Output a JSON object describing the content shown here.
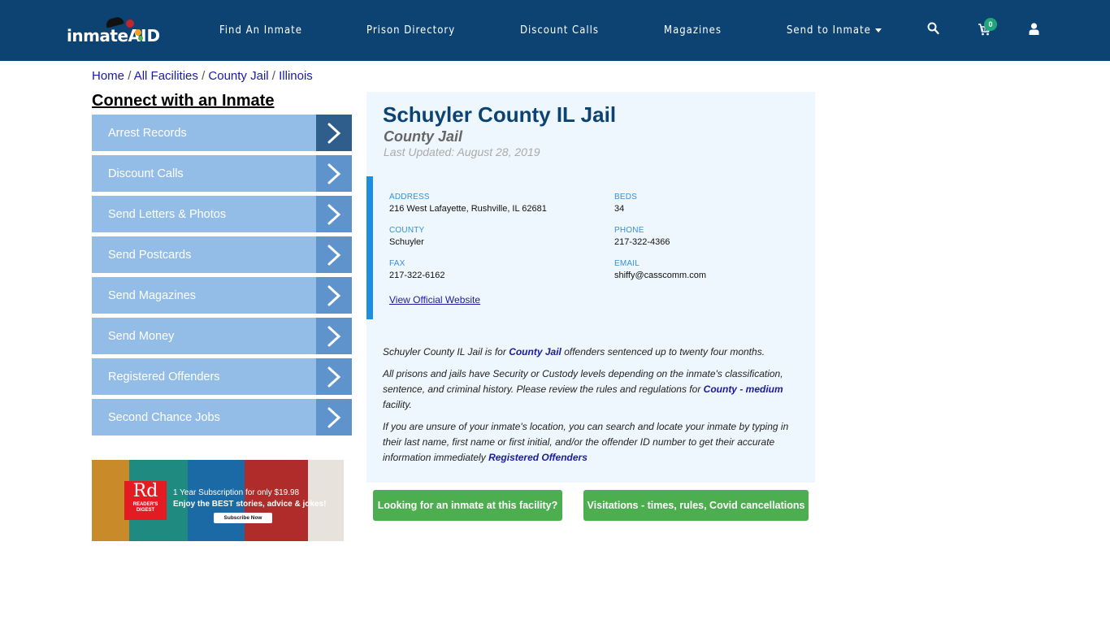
{
  "nav": {
    "logo_text": "inmate",
    "logo_aid": "AID",
    "links": [
      "Find An Inmate",
      "Prison Directory",
      "Discount Calls",
      "Magazines",
      "Send to Inmate"
    ],
    "cart_count": "0"
  },
  "breadcrumb": {
    "items": [
      "Home",
      "All Facilities",
      "County Jail",
      "Illinois"
    ],
    "separator": "/"
  },
  "sidebar": {
    "title": "Connect with an Inmate",
    "items": [
      "Arrest Records",
      "Discount Calls",
      "Send Letters & Photos",
      "Send Postcards",
      "Send Magazines",
      "Send Money",
      "Registered Offenders",
      "Second Chance Jobs"
    ]
  },
  "ad": {
    "logo": "Rd",
    "brand": "READER'S DIGEST",
    "line1": "1 Year Subscription for only $19.98",
    "line2": "Enjoy the BEST stories, advice & jokes!",
    "button": "Subscribe Now",
    "cover_colors": [
      "#c98a2a",
      "#1f8a80",
      "#1b6aa5",
      "#b02c2a",
      "#e8e2dc"
    ]
  },
  "facility": {
    "title": "Schuyler County IL Jail",
    "type": "County Jail",
    "last_updated": "Last Updated: August 28, 2019",
    "fields": {
      "address_label": "ADDRESS",
      "address": "216 West Lafayette, Rushville, IL 62681",
      "beds_label": "BEDS",
      "beds": "34",
      "county_label": "COUNTY",
      "county": "Schuyler",
      "phone_label": "PHONE",
      "phone": "217-322-4366",
      "fax_label": "FAX",
      "fax": "217-322-6162",
      "email_label": "EMAIL",
      "email": "shiffy@casscomm.com"
    },
    "website_link": "View Official Website",
    "description": {
      "p1_a": "Schuyler County IL Jail is for ",
      "p1_link": "County Jail",
      "p1_b": " offenders sentenced up to twenty four months.",
      "p2_a": "All prisons and jails have Security or Custody levels depending on the inmate's classification, sentence, and criminal history. Please review the rules and regulations for ",
      "p2_link": "County - medium",
      "p2_b": " facility.",
      "p3_a": "If you are unsure of your inmate's location, you can search and locate your inmate by typing in their last name, first name or first initial, and/or the offender ID number to get their accurate information immediately ",
      "p3_link": "Registered Offenders"
    }
  },
  "buttons": {
    "find_inmate": "Looking for an inmate at this facility?",
    "visitations": "Visitations - times, rules, Covid cancellations"
  }
}
